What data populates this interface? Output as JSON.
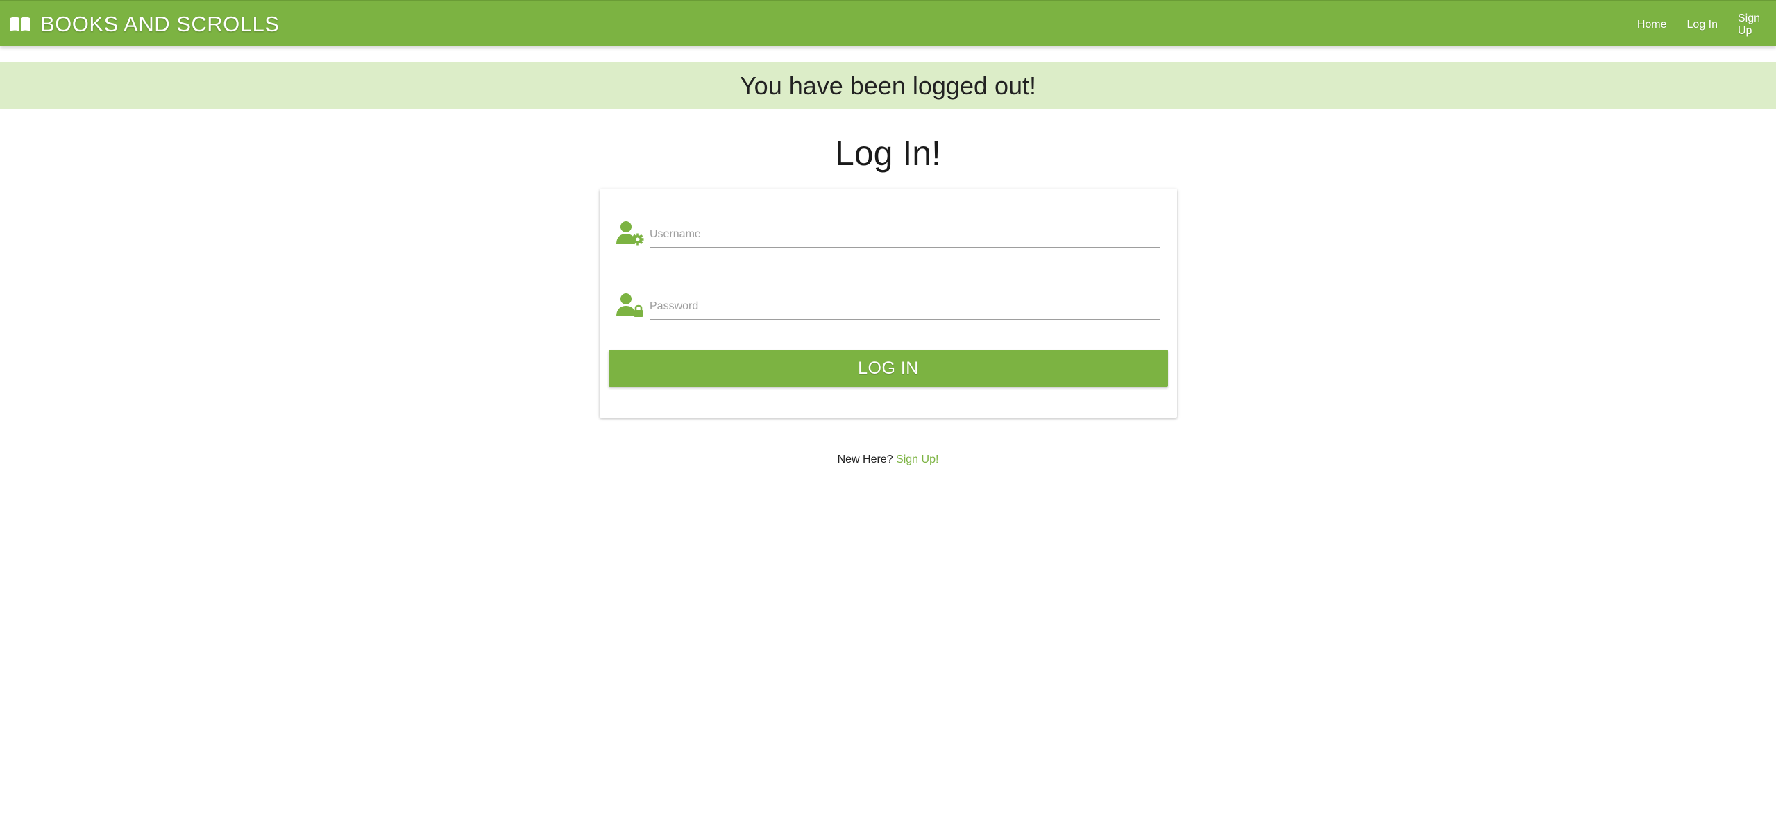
{
  "navbar": {
    "brand_icon": "open-book-icon",
    "brand_text": "BOOKS AND SCROLLS",
    "links": [
      {
        "label": "Home"
      },
      {
        "label": "Log In"
      },
      {
        "label": "Sign Up"
      }
    ],
    "color": "#7cb342"
  },
  "flash": {
    "message": "You have been logged out!",
    "background": "#dcedc8"
  },
  "page": {
    "title": "Log In!"
  },
  "form": {
    "username": {
      "icon": "user-gear-icon",
      "placeholder": "Username",
      "value": ""
    },
    "password": {
      "icon": "user-lock-icon",
      "placeholder": "Password",
      "value": ""
    },
    "submit_label": "LOG IN"
  },
  "footer": {
    "prompt": "New Here?",
    "link_label": "Sign Up!"
  }
}
